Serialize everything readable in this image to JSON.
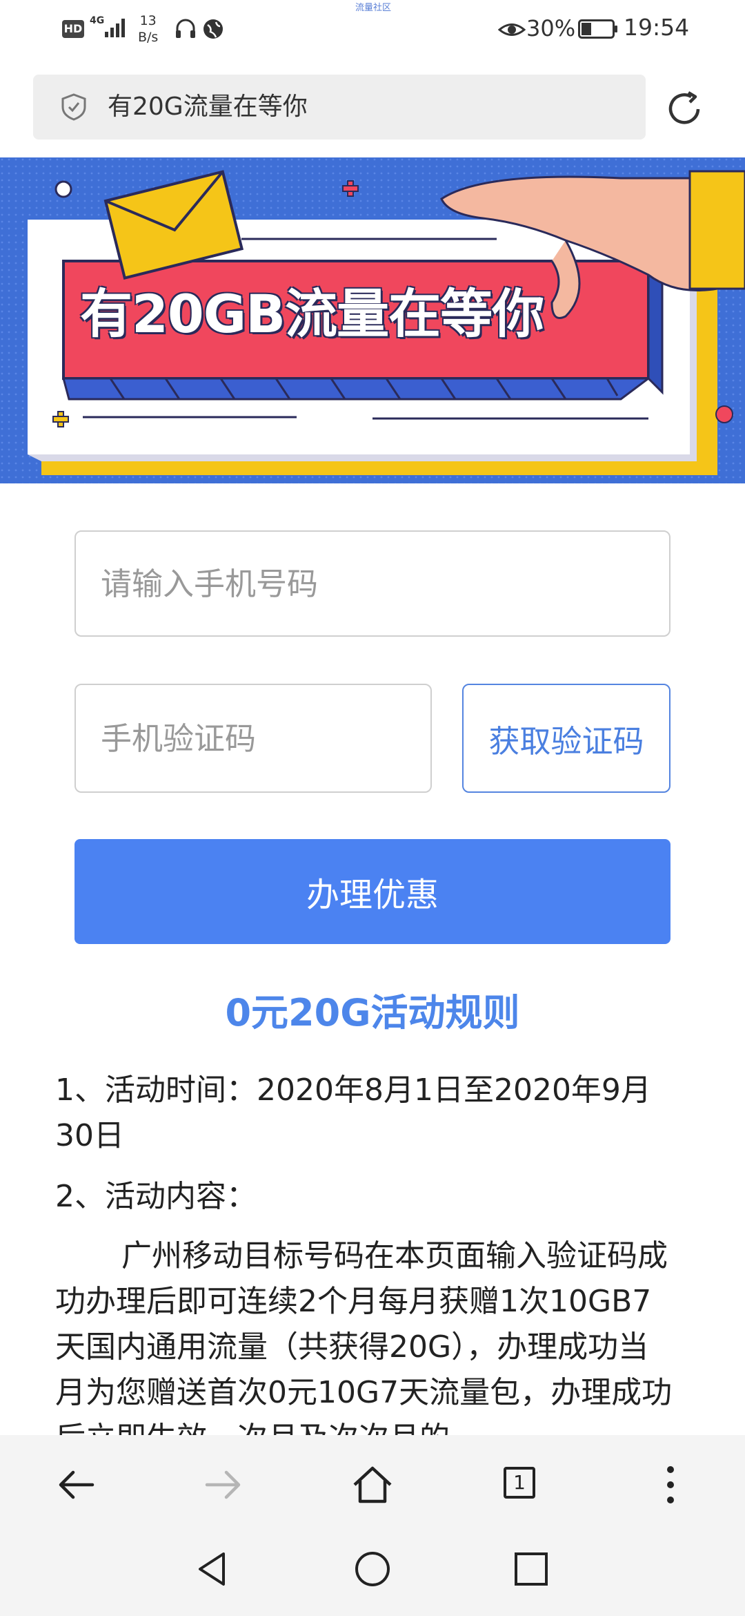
{
  "status_bar": {
    "watermark": "流量社区",
    "hd": "HD",
    "network": "4G",
    "speed": "13\nB/s",
    "battery_pct": "30%",
    "time": "19:54"
  },
  "address_bar": {
    "title": "有20G流量在等你"
  },
  "banner": {
    "headline": "有20GB流量在等你",
    "colors": {
      "background": "#3f6fd6",
      "card": "#f0475d",
      "accent": "#f5c518"
    }
  },
  "form": {
    "phone_placeholder": "请输入手机号码",
    "code_placeholder": "手机验证码",
    "get_code_label": "获取验证码",
    "submit_label": "办理优惠"
  },
  "rules": {
    "title": "0元20G活动规则",
    "item1": "1、活动时间：2020年8月1日至2020年9月30日",
    "item2": "2、活动内容：",
    "item2_body": "广州移动目标号码在本页面输入验证码成功办理后即可连续2个月每月获赠1次10GB7天国内通用流量（共获得20G），办理成功当月为您赠送首次0元10G7天流量包，办理成功后立即生效，次月及次次月的"
  },
  "browser_nav": {
    "tab_count": "1",
    "icons": [
      "back-icon",
      "forward-icon",
      "home-icon",
      "tabs-icon",
      "more-icon"
    ]
  },
  "system_nav": {
    "icons": [
      "system-back-icon",
      "system-home-icon",
      "system-recents-icon"
    ]
  }
}
